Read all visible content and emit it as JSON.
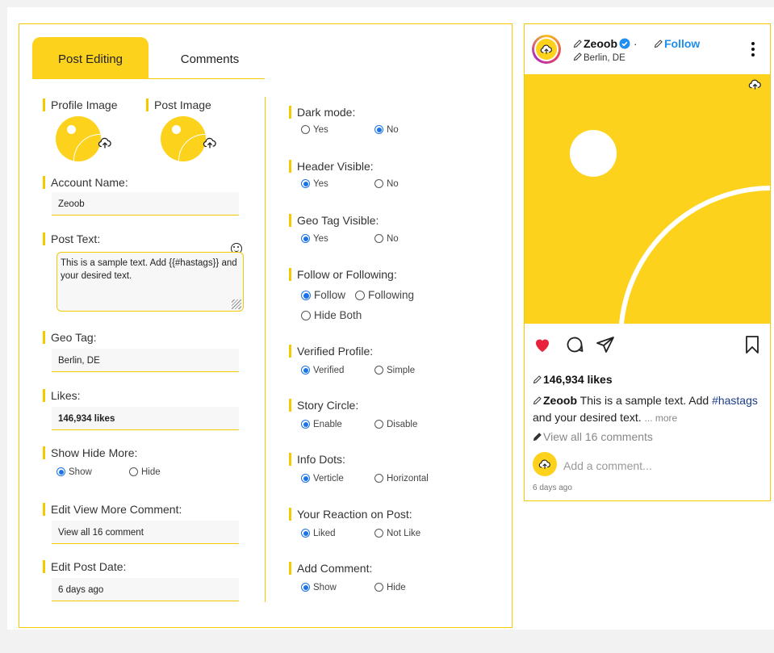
{
  "tabs": [
    {
      "label": "Post Editing",
      "active": true
    },
    {
      "label": "Comments",
      "active": false
    }
  ],
  "left": {
    "profile_image_label": "Profile Image",
    "post_image_label": "Post Image",
    "account_name": {
      "label": "Account Name:",
      "value": "Zeoob"
    },
    "post_text": {
      "label": "Post Text:",
      "value": "This is a sample text. Add {{#hastags}} and your desired text."
    },
    "geo_tag": {
      "label": "Geo Tag:",
      "value": "Berlin, DE"
    },
    "likes": {
      "label": "Likes:",
      "value": "146,934 likes"
    },
    "show_hide_more": {
      "label": "Show Hide More:",
      "options": [
        "Show",
        "Hide"
      ],
      "selected": "Show"
    },
    "view_more_comment": {
      "label": "Edit View More Comment:",
      "value": "View all 16 comment"
    },
    "post_date": {
      "label": "Edit Post Date:",
      "value": "6 days ago"
    }
  },
  "right": {
    "dark_mode": {
      "label": "Dark mode:",
      "options": [
        "Yes",
        "No"
      ],
      "selected": "No"
    },
    "header_visible": {
      "label": "Header Visible:",
      "options": [
        "Yes",
        "No"
      ],
      "selected": "Yes"
    },
    "geo_tag_visible": {
      "label": "Geo Tag Visible:",
      "options": [
        "Yes",
        "No"
      ],
      "selected": "Yes"
    },
    "follow_or_following": {
      "label": "Follow or Following:",
      "options": [
        "Follow",
        "Following",
        "Hide Both"
      ],
      "selected": "Follow"
    },
    "verified_profile": {
      "label": "Verified Profile:",
      "options": [
        "Verified",
        "Simple"
      ],
      "selected": "Verified"
    },
    "story_circle": {
      "label": "Story Circle:",
      "options": [
        "Enable",
        "Disable"
      ],
      "selected": "Enable"
    },
    "info_dots": {
      "label": "Info Dots:",
      "options": [
        "Verticle",
        "Horizontal"
      ],
      "selected": "Verticle"
    },
    "reaction": {
      "label": "Your Reaction on Post:",
      "options": [
        "Liked",
        "Not Like"
      ],
      "selected": "Liked"
    },
    "add_comment": {
      "label": "Add Comment:",
      "options": [
        "Show",
        "Hide"
      ],
      "selected": "Show"
    }
  },
  "preview": {
    "username": "Zeoob",
    "separator": "·",
    "follow": "Follow",
    "location": "Berlin, DE",
    "likes": "146,934 likes",
    "caption_user": "Zeoob",
    "caption_pre": "This is a sample text. Add",
    "caption_tag": "#hastags",
    "caption_post": "and your desired text.",
    "more": "... more",
    "view_comments": "View all 16 comments",
    "add_comment_placeholder": "Add a comment...",
    "date": "6 days ago"
  },
  "colors": {
    "accent": "#fcd21c",
    "border": "#f5c800",
    "radio": "#1a73e8",
    "follow": "#1f8ef1",
    "heart": "#e8223c"
  }
}
